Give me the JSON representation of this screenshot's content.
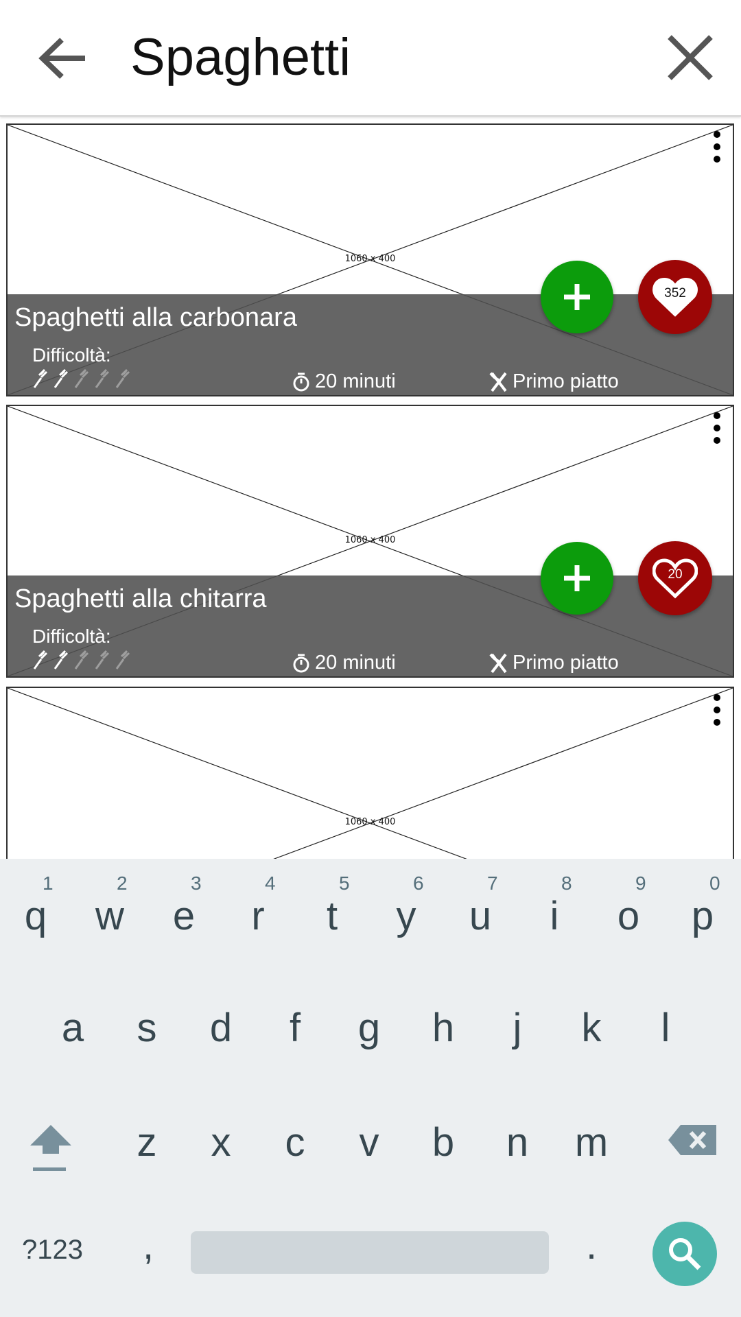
{
  "search": {
    "query": "Spaghetti"
  },
  "placeholder_label": "1060 x 400",
  "recipes": [
    {
      "title": "Spaghetti alla carbonara",
      "difficulty_label": "Difficoltà:",
      "difficulty": 2,
      "difficulty_max": 5,
      "time": "20 minuti",
      "course": "Primo piatto",
      "likes": "352",
      "liked": true
    },
    {
      "title": "Spaghetti alla chitarra",
      "difficulty_label": "Difficoltà:",
      "difficulty": 2,
      "difficulty_max": 5,
      "time": "20 minuti",
      "course": "Primo piatto",
      "likes": "20",
      "liked": false
    }
  ],
  "keyboard": {
    "row1": [
      "q",
      "w",
      "e",
      "r",
      "t",
      "y",
      "u",
      "i",
      "o",
      "p"
    ],
    "row1_hints": [
      "1",
      "2",
      "3",
      "4",
      "5",
      "6",
      "7",
      "8",
      "9",
      "0"
    ],
    "row2": [
      "a",
      "s",
      "d",
      "f",
      "g",
      "h",
      "j",
      "k",
      "l"
    ],
    "row3": [
      "z",
      "x",
      "c",
      "v",
      "b",
      "n",
      "m"
    ],
    "symbols_label": "?123",
    "comma": ",",
    "period": "."
  },
  "colors": {
    "add": "#0c9c0c",
    "favorite": "#9c0606",
    "search_key": "#4db6ac",
    "keyboard_bg": "#eceff1"
  }
}
